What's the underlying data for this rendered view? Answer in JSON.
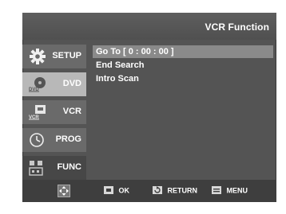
{
  "window": {
    "title": "VCR Function"
  },
  "sidebar": {
    "items": [
      {
        "label": "SETUP",
        "icon": "gear-icon"
      },
      {
        "label": "DVD",
        "icon": "dvd-disc-icon"
      },
      {
        "label": "VCR",
        "icon": "vcr-tape-icon"
      },
      {
        "label": "PROG",
        "icon": "clock-icon"
      },
      {
        "label": "FUNC",
        "icon": "func-grid-icon"
      }
    ],
    "active": "FUNC"
  },
  "menu": {
    "items": [
      {
        "label": "Go To [ 0 : 00 : 00 ]",
        "selected": true
      },
      {
        "label": "End Search",
        "selected": false
      },
      {
        "label": "Intro Scan",
        "selected": false
      }
    ]
  },
  "footer": {
    "hints": [
      {
        "icon": "dpad-icon",
        "label": ""
      },
      {
        "icon": "ok-icon",
        "label": "OK"
      },
      {
        "icon": "return-icon",
        "label": "RETURN"
      },
      {
        "icon": "menu-icon",
        "label": "MENU"
      }
    ]
  },
  "colors": {
    "panel": "#545454",
    "title_bar": "#575757",
    "sidebar_item": "#6a6a6a",
    "sidebar_item_light": "#b8b8b8",
    "sidebar_item_active": "#474747",
    "highlight": "#8a8a8a",
    "footer": "#3e3e3e"
  }
}
